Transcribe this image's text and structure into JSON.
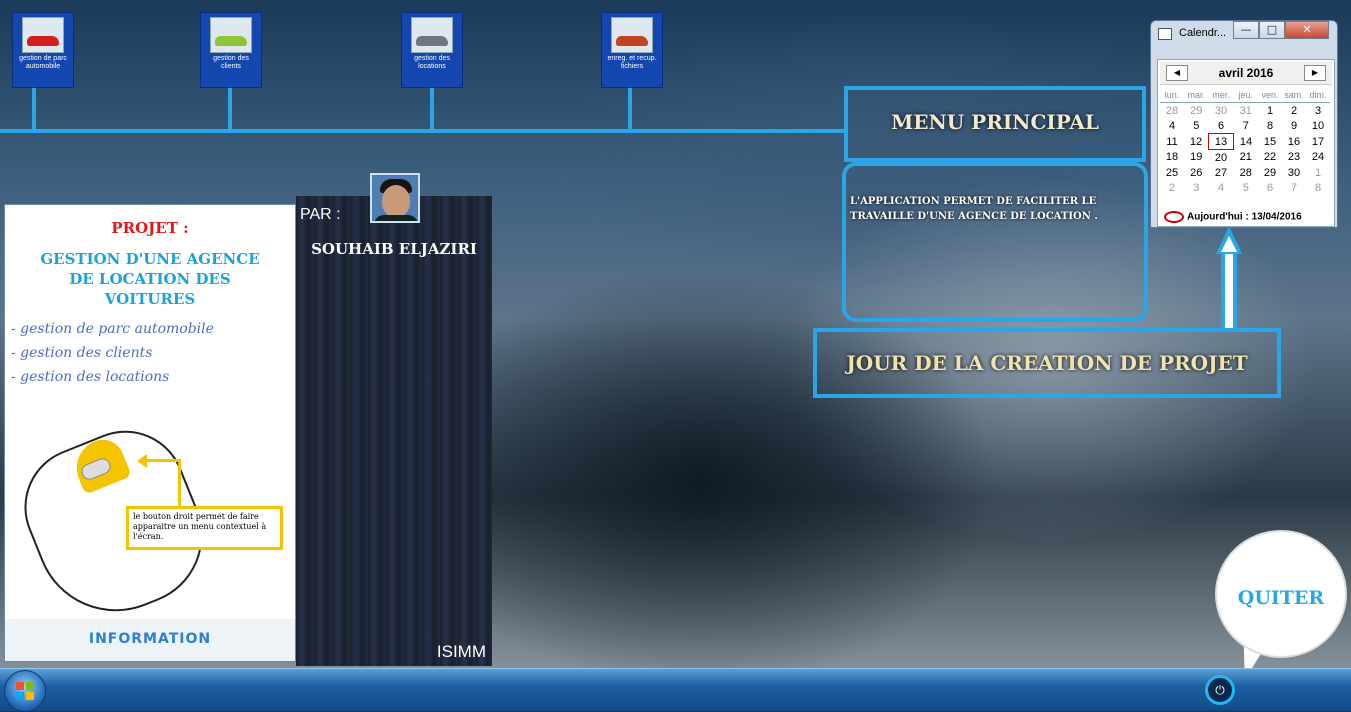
{
  "shortcuts": [
    {
      "label": "gestion de parc automobile",
      "icon": "red-car-icon",
      "car_color": "#d21e1e"
    },
    {
      "label": "gestion des clients",
      "icon": "green-car-icon",
      "car_color": "#8dc43a"
    },
    {
      "label": "gestion des locations",
      "icon": "silver-car-icon",
      "car_color": "#6e7780"
    },
    {
      "label": "enreg. et recup. fichiers",
      "icon": "orange-car-icon",
      "car_color": "#c2431f"
    }
  ],
  "menu": {
    "title": "MENU PRINCIPAL",
    "description": "L'APPLICATION PERMET DE FACILITER LE TRAVAILLE D'UNE AGENCE DE LOCATION ."
  },
  "jour_label": "JOUR DE LA CREATION DE PROJET",
  "calendar": {
    "window_title": "Calendr...",
    "month_label": "avril 2016",
    "day_names": [
      "lun.",
      "mar.",
      "mer.",
      "jeu.",
      "ven.",
      "sam.",
      "dim."
    ],
    "weeks": [
      [
        "28",
        "29",
        "30",
        "31",
        "1",
        "2",
        "3"
      ],
      [
        "4",
        "5",
        "6",
        "7",
        "8",
        "9",
        "10"
      ],
      [
        "11",
        "12",
        "13",
        "14",
        "15",
        "16",
        "17"
      ],
      [
        "18",
        "19",
        "20",
        "21",
        "22",
        "23",
        "24"
      ],
      [
        "25",
        "26",
        "27",
        "28",
        "29",
        "30",
        "1"
      ],
      [
        "2",
        "3",
        "4",
        "5",
        "6",
        "7",
        "8"
      ]
    ],
    "selected_day": "13",
    "today_text": "Aujourd'hui : 13/04/2016"
  },
  "panel": {
    "projet_label": "PROJET :",
    "project_title": "GESTION D'UNE AGENCE DE LOCATION DES VOITURES",
    "items": [
      "- gestion de parc automobile",
      "- gestion des clients",
      "- gestion des locations"
    ],
    "mouse_hint": "le  bouton droit permet de faire apparaitre un menu contextuel à l'écran.",
    "info_label": "INFORMATION"
  },
  "author": {
    "par_label": "PAR :",
    "name": "SOUHAIB ELJAZIRI",
    "school": "ISIMM"
  },
  "quit_label": "QUITER",
  "colors": {
    "accent": "#2aa6e6",
    "title_red": "#e21818",
    "highlight": "#f5c400"
  }
}
